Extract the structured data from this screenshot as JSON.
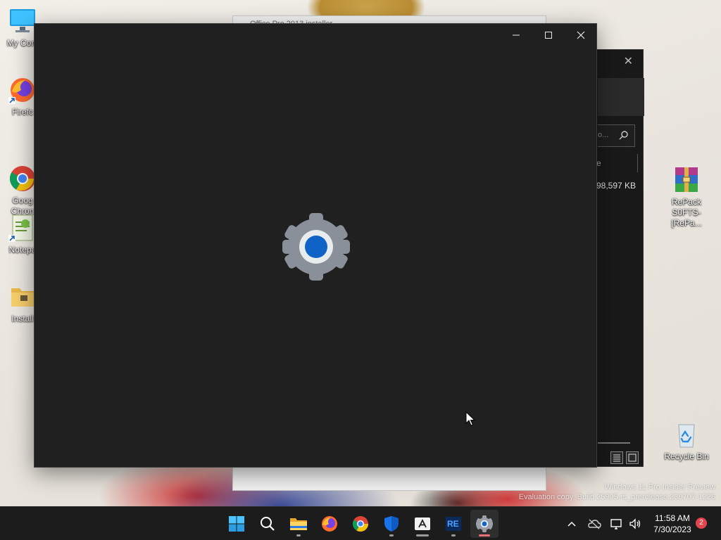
{
  "desktop": {
    "icons": [
      {
        "label": "My Com",
        "icon": "computer-icon"
      },
      {
        "label": "Firefc",
        "icon": "firefox-icon"
      },
      {
        "label": "Goog\nChron",
        "icon": "chrome-icon"
      },
      {
        "label": "Notepa",
        "icon": "notepad-icon"
      },
      {
        "label": "Install",
        "icon": "folder-icon"
      },
      {
        "label": "RePack\nS0FTS-[RePa...",
        "icon": "winrar-archive-icon"
      },
      {
        "label": "Recycle Bin",
        "icon": "recycle-bin-icon"
      }
    ]
  },
  "background_windows": {
    "installer_title": "Office Pro 2013 installer",
    "explorer": {
      "search_placeholder": "o...",
      "column_header": "e",
      "file_size": "98,597 KB"
    }
  },
  "main_window": {
    "app": "Settings",
    "state": "loading",
    "controls": {
      "minimize": "minimize-icon",
      "maximize": "maximize-icon",
      "close": "close-icon"
    }
  },
  "watermark": {
    "line1": "Windows 11 Pro Insider Preview",
    "line2": "Evaluation copy. Build 25905.rs_prerelease.230707-1226"
  },
  "taskbar": {
    "apps": [
      "windows-start-icon",
      "search-icon",
      "file-explorer-icon",
      "firefox-icon",
      "chrome-icon",
      "windows-security-icon",
      "app-store-icon",
      "re-app-icon",
      "settings-icon"
    ],
    "tray": [
      "chevron-up-icon",
      "onedrive-icon",
      "network-icon",
      "volume-icon"
    ],
    "clock": {
      "time": "11:58 AM",
      "date": "7/30/2023"
    },
    "notification_count": "2"
  },
  "colors": {
    "window_bg": "#202020",
    "taskbar_bg": "#1c1c1c",
    "accent_blue": "#0f62c6",
    "gear_gray": "#8a9099"
  }
}
